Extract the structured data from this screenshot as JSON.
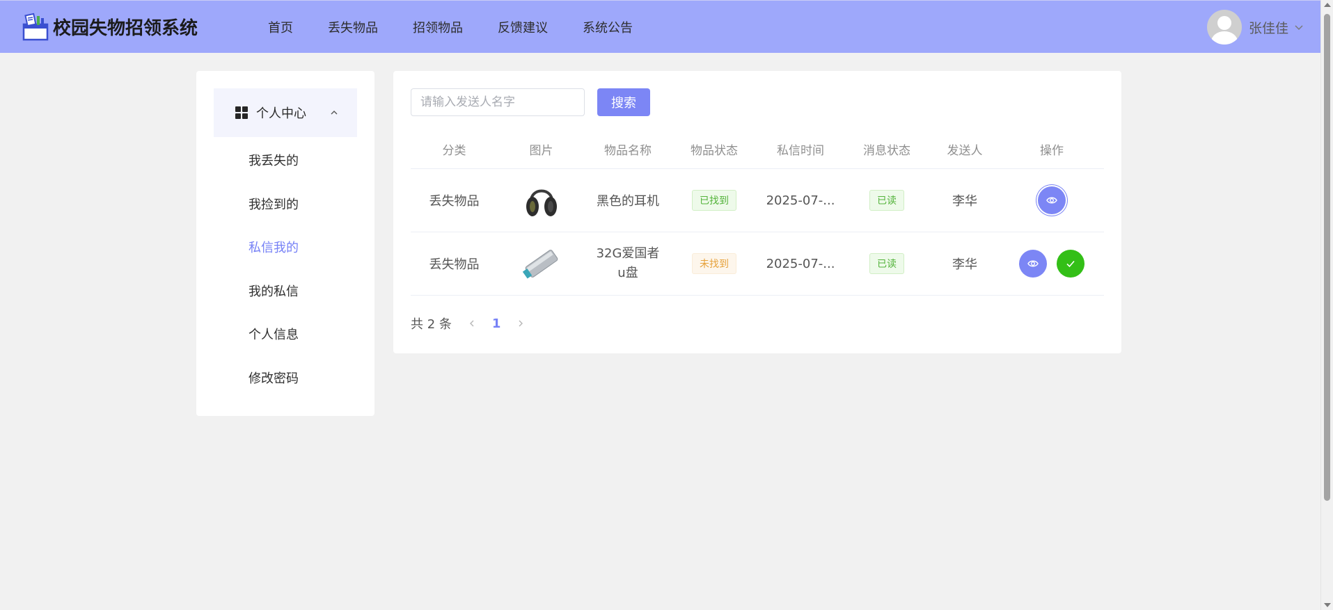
{
  "header": {
    "logo_text": "校园失物招领系统",
    "nav": [
      "首页",
      "丢失物品",
      "招领物品",
      "反馈建议",
      "系统公告"
    ],
    "user_name": "张佳佳"
  },
  "sidebar": {
    "group_label": "个人中心",
    "items": [
      {
        "label": "我丢失的",
        "active": false
      },
      {
        "label": "我捡到的",
        "active": false
      },
      {
        "label": "私信我的",
        "active": true
      },
      {
        "label": "我的私信",
        "active": false
      },
      {
        "label": "个人信息",
        "active": false
      },
      {
        "label": "修改密码",
        "active": false
      }
    ]
  },
  "search": {
    "placeholder": "请输入发送人名字",
    "value": "",
    "button_label": "搜索"
  },
  "table": {
    "headers": [
      "分类",
      "图片",
      "物品名称",
      "物品状态",
      "私信时间",
      "消息状态",
      "发送人",
      "操作"
    ],
    "rows": [
      {
        "category": "丢失物品",
        "image": "headphones",
        "name": "黑色的耳机",
        "item_status": "已找到",
        "time": "2025-07-...",
        "msg_status": "已读",
        "sender": "李华"
      },
      {
        "category": "丢失物品",
        "image": "usb-drive",
        "name": "32G爱国者u盘",
        "item_status": "未找到",
        "time": "2025-07-...",
        "msg_status": "已读",
        "sender": "李华"
      }
    ]
  },
  "pagination": {
    "total_text": "共 2 条",
    "current_page": "1"
  },
  "colors": {
    "header_bg": "#9ea8fb",
    "accent": "#7c86f5",
    "success": "#33bf17",
    "warning": "#e6a23c"
  }
}
